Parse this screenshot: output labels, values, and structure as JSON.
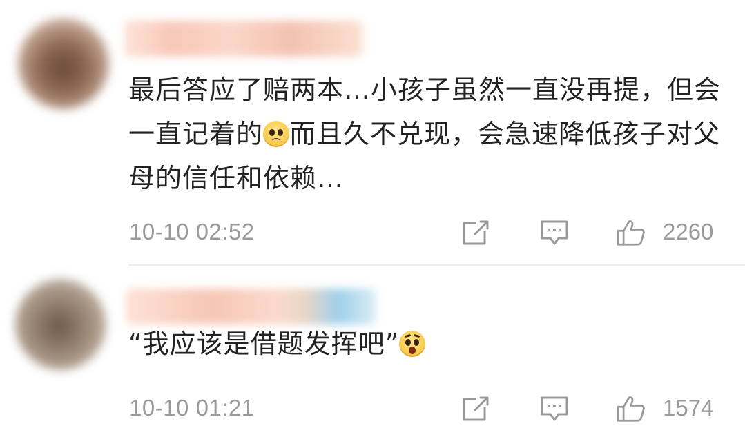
{
  "comments": [
    {
      "text_part1": "最后答应了赔两本…小孩子虽然一直没再提，但会一直记着的",
      "emoji": "sad-face-emoji",
      "text_part2": "而且久不兑现，会急速降低孩子对父母的信任和依赖…",
      "time": "10-10 02:52",
      "like_count": "2260"
    },
    {
      "text_part1": "“我应该是借题发挥吧”",
      "emoji": "shocked-face-emoji",
      "text_part2": "",
      "time": "10-10 01:21",
      "like_count": "1574"
    }
  ],
  "colors": {
    "text": "#222222",
    "meta": "#9a9a9a",
    "divider": "#ececec"
  }
}
